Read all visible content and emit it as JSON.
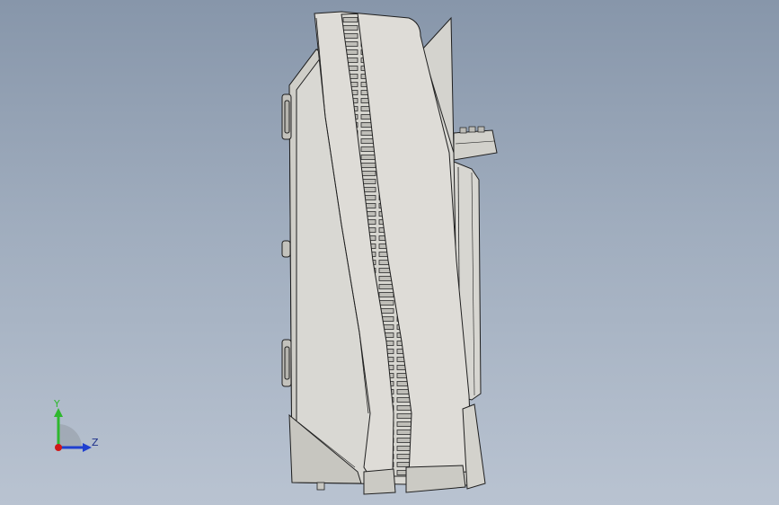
{
  "colors": {
    "background_top": "#8796aa",
    "background_bottom": "#b9c3d1",
    "part_face": "#d9d8d3",
    "part_shade": "#c8c7c1",
    "edge": "#1f1f1f",
    "axis_y": "#2eb82e",
    "axis_z": "#1f3fcf",
    "axis_x_origin": "#d01818",
    "axis_label": "#1c2f8a"
  },
  "triad": {
    "y_label": "Y",
    "z_label": "Z"
  },
  "model": {
    "view": "side",
    "icon": "enclosure-side-view"
  }
}
